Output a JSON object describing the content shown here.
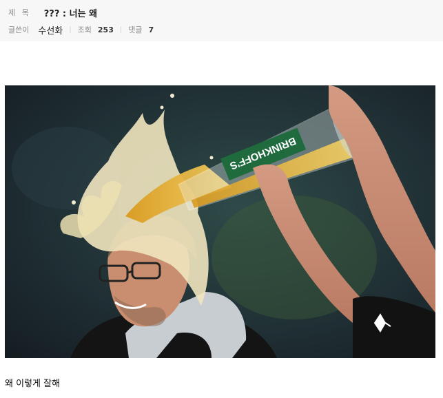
{
  "post": {
    "title_label": "제 목",
    "title": "??? : 너는 왜",
    "author_label": "글쓴이",
    "author": "수선화",
    "views_label": "조회",
    "views": "253",
    "comments_label": "댓글",
    "comments": "7",
    "separator": "|"
  },
  "image": {
    "bottle_text": "BRINKHOFF'S"
  },
  "body": {
    "caption": "왜 이렇게 잘해"
  }
}
